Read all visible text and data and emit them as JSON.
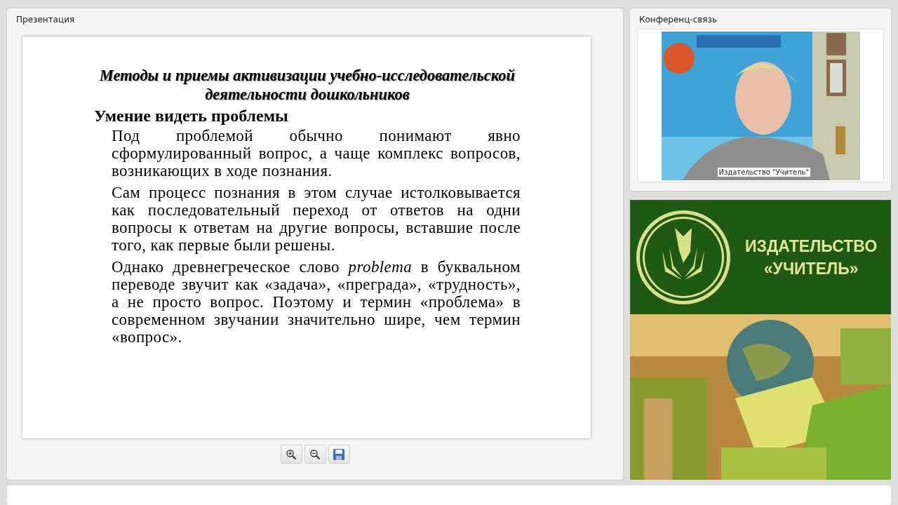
{
  "presentation": {
    "title": "Презентация",
    "slide": {
      "title": "Методы и приемы активизации учебно-исследовательской деятельности дошкольников",
      "heading": "Умение видеть проблемы",
      "paragraphs": [
        "Под проблемой обычно понимают явно сформулированный вопрос, а чаще комплекс вопросов, возникающих в ходе познания.",
        "Сам процесс познания в этом случае истолковывается как последовательный переход от ответов на одни вопросы к ответам на другие вопросы, вставшие после того, как первые были решены.",
        "Однако древнегреческое слово *problema* в буквальном переводе звучит как «задача», «преграда», «трудность», а не просто вопрос. Поэтому и термин «проблема» в современном звучании значительно шире, чем термин «вопрос»."
      ]
    },
    "tools": [
      {
        "kind": "zoom-in"
      },
      {
        "kind": "zoom-out"
      },
      {
        "kind": "save"
      }
    ]
  },
  "conference": {
    "title": "Конференц-связь",
    "video": {
      "kind": "picture",
      "caption": "Издательство \"Учитель\""
    }
  },
  "banner": {
    "name_line_1": "ИЗДАТЕЛЬСТВО",
    "name_line_2": "«УЧИТЕЛЬ»"
  }
}
